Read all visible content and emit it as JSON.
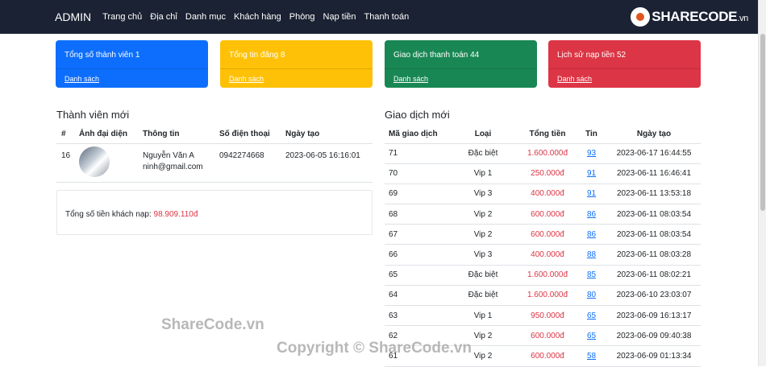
{
  "nav": {
    "brand": "ADMIN",
    "items": [
      "Trang chủ",
      "Địa chỉ",
      "Danh mục",
      "Khách hàng",
      "Phòng",
      "Nạp tiền",
      "Thanh toán"
    ]
  },
  "logo": {
    "text": "SHARECODE",
    "tld": ".vn"
  },
  "cards": [
    {
      "title": "Tổng số thành viên 1",
      "link": "Danh sách",
      "color": "#0d6efd"
    },
    {
      "title": "Tổng tin đăng 8",
      "link": "Danh sách",
      "color": "#ffc107"
    },
    {
      "title": "Giao dịch thanh toán 44",
      "link": "Danh sách",
      "color": "#198754"
    },
    {
      "title": "Lịch sử nạp tiền 52",
      "link": "Danh sách",
      "color": "#dc3545"
    }
  ],
  "members": {
    "title": "Thành viên mới",
    "headers": [
      "#",
      "Ảnh đại diện",
      "Thông tin",
      "Số điện thoại",
      "Ngày tạo"
    ],
    "rows": [
      {
        "id": "16",
        "name": "Nguyễn Văn A",
        "email": "ninh@gmail.com",
        "phone": "0942274668",
        "created": "2023-06-05 16:16:01"
      }
    ]
  },
  "summary": {
    "label": "Tổng số tiền khách nạp:",
    "value": "98.909.110đ"
  },
  "transactions": {
    "title": "Giao dịch mới",
    "headers": [
      "Mã giao dịch",
      "Loại",
      "Tổng tiền",
      "Tin",
      "Ngày tạo"
    ],
    "rows": [
      [
        "71",
        "Đặc biệt",
        "1.600.000đ",
        "93",
        "2023-06-17 16:44:55"
      ],
      [
        "70",
        "Vip 1",
        "250.000đ",
        "91",
        "2023-06-11 16:46:41"
      ],
      [
        "69",
        "Vip 3",
        "400.000đ",
        "91",
        "2023-06-11 13:53:18"
      ],
      [
        "68",
        "Vip 2",
        "600.000đ",
        "86",
        "2023-06-11 08:03:54"
      ],
      [
        "67",
        "Vip 2",
        "600.000đ",
        "86",
        "2023-06-11 08:03:54"
      ],
      [
        "66",
        "Vip 3",
        "400.000đ",
        "88",
        "2023-06-11 08:03:28"
      ],
      [
        "65",
        "Đặc biệt",
        "1.600.000đ",
        "85",
        "2023-06-11 08:02:21"
      ],
      [
        "64",
        "Đặc biệt",
        "1.600.000đ",
        "80",
        "2023-06-10 23:03:07"
      ],
      [
        "63",
        "Vip 1",
        "950.000đ",
        "65",
        "2023-06-09 16:13:17"
      ],
      [
        "62",
        "Vip 2",
        "600.000đ",
        "65",
        "2023-06-09 09:40:38"
      ],
      [
        "61",
        "Vip 2",
        "600.000đ",
        "58",
        "2023-06-09 01:13:34"
      ]
    ]
  },
  "watermarks": [
    "ShareCode.vn",
    "Copyright © ShareCode.vn"
  ]
}
